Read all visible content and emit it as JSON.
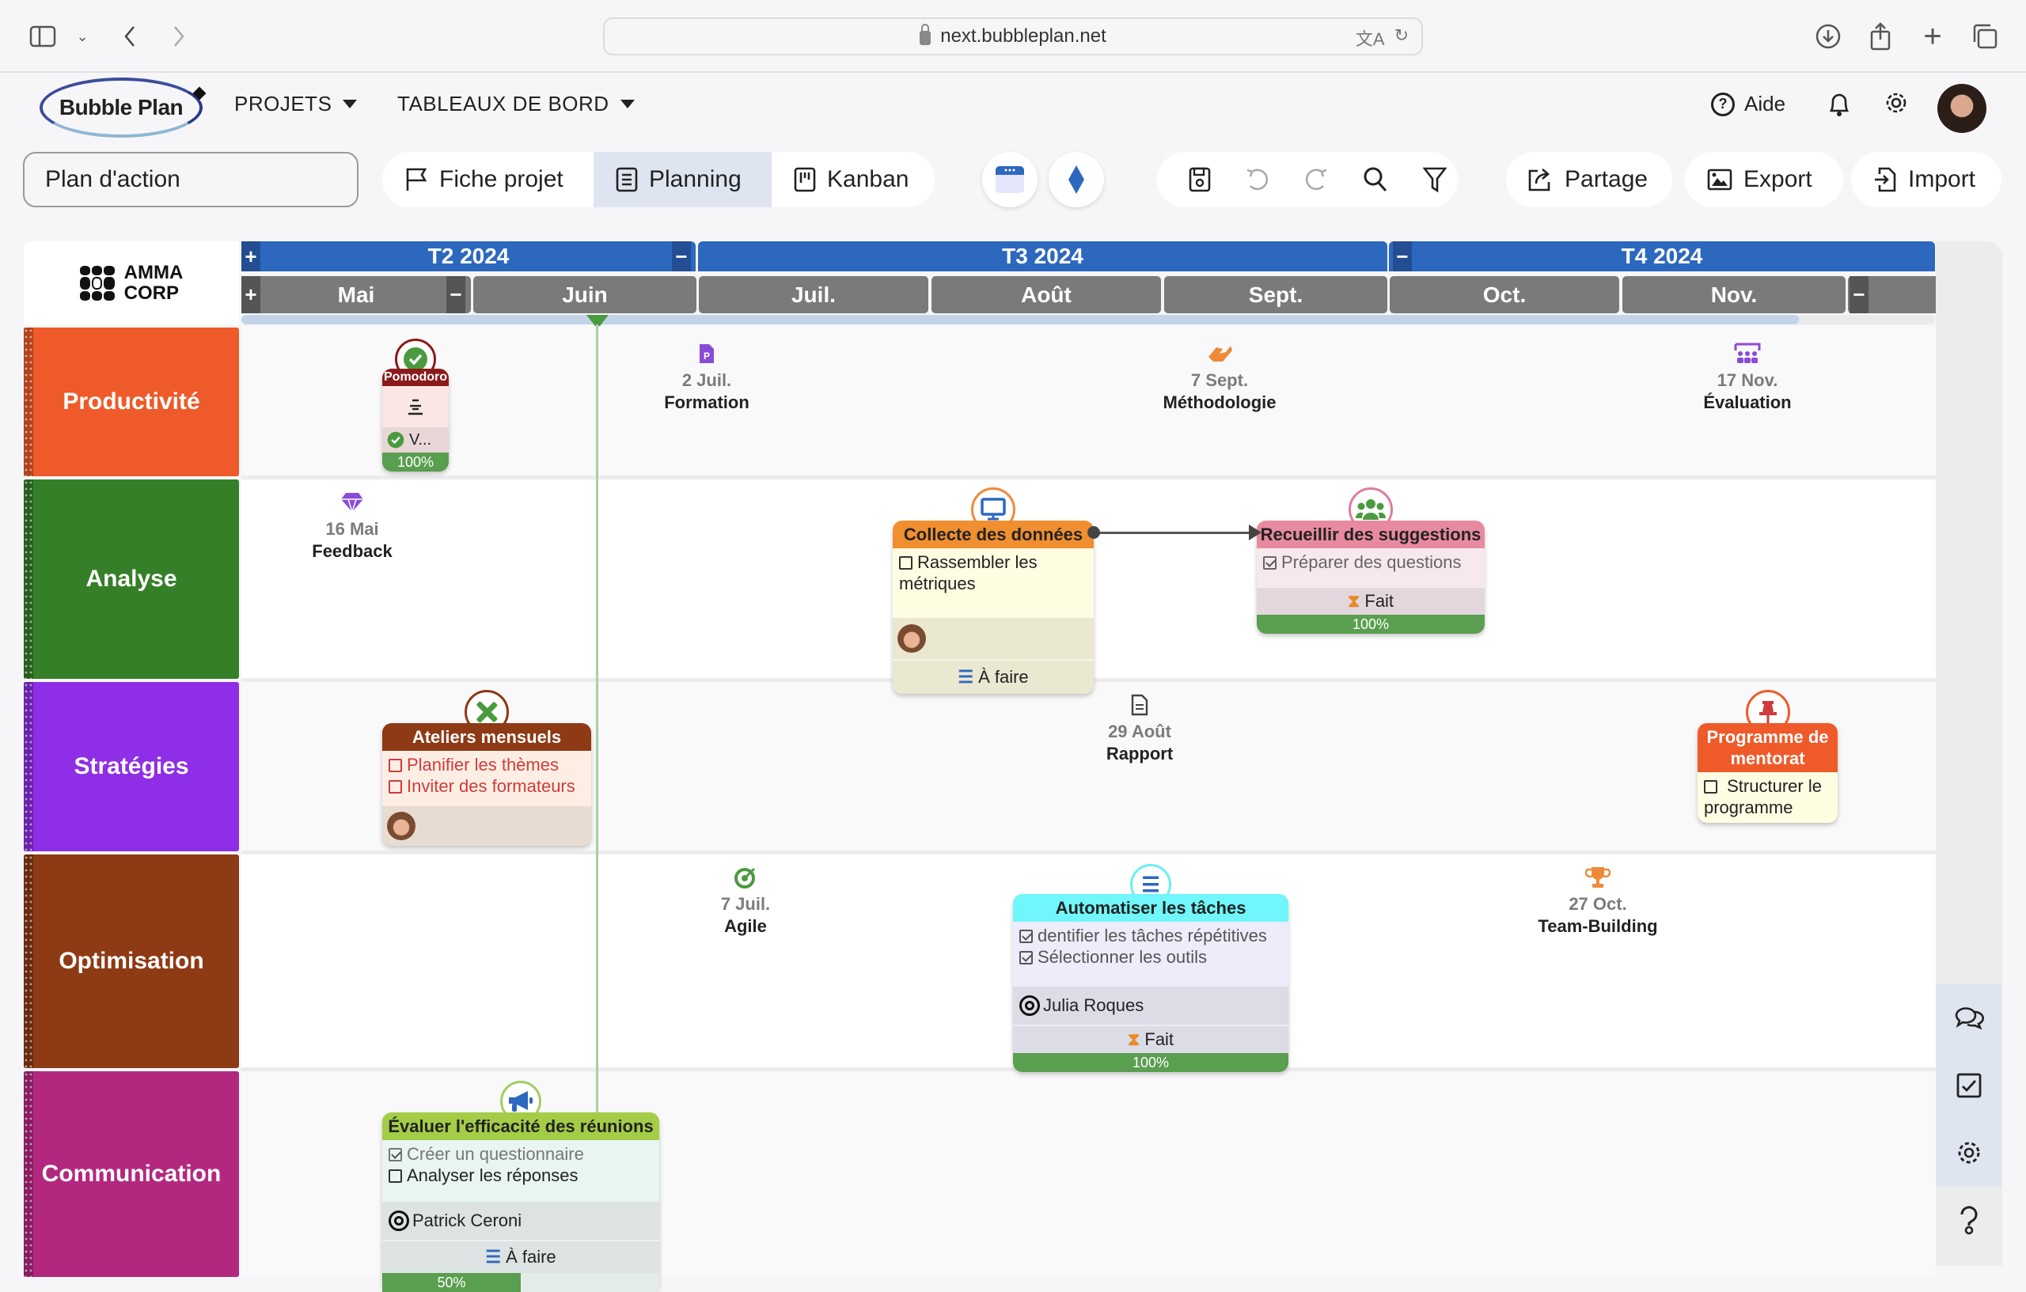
{
  "browser": {
    "url": "next.bubbleplan.net",
    "icons": [
      "sidebar-icon",
      "chevron-down-icon",
      "back-icon",
      "forward-icon",
      "translate-icon",
      "reload-icon",
      "download-icon",
      "share-icon",
      "new-tab-icon",
      "tabs-icon"
    ]
  },
  "appnav": {
    "logo": "Bubble Plan",
    "menus": [
      {
        "label": "PROJETS"
      },
      {
        "label": "TABLEAUX DE BORD"
      }
    ],
    "help_label": "Aide"
  },
  "toolbar": {
    "project_name": "Plan d'action",
    "views": [
      {
        "label": "Fiche projet",
        "icon": "flag-icon",
        "active": false
      },
      {
        "label": "Planning",
        "icon": "planning-icon",
        "active": true
      },
      {
        "label": "Kanban",
        "icon": "kanban-icon",
        "active": false
      }
    ],
    "actions": [
      "save-icon",
      "undo-icon",
      "redo-icon",
      "search-icon",
      "filter-icon"
    ],
    "share_label": "Partage",
    "export_label": "Export",
    "import_label": "Import"
  },
  "timeline": {
    "company": {
      "line1": "AMMA",
      "line2": "CORP"
    },
    "quarters": [
      {
        "label": "T2 2024"
      },
      {
        "label": "T3 2024"
      },
      {
        "label": "T4 2024"
      }
    ],
    "months": [
      {
        "label": "Mai"
      },
      {
        "label": "Juin"
      },
      {
        "label": "Juil."
      },
      {
        "label": "Août"
      },
      {
        "label": "Sept."
      },
      {
        "label": "Oct."
      },
      {
        "label": "Nov."
      }
    ],
    "controls": {
      "plus": "+",
      "minus": "−"
    },
    "today_month": "Juin"
  },
  "lanes": [
    {
      "label": "Productivité",
      "color": "#ee5a29"
    },
    {
      "label": "Analyse",
      "color": "#357f28"
    },
    {
      "label": "Stratégies",
      "color": "#8e2ee6"
    },
    {
      "label": "Optimisation",
      "color": "#8d3a15"
    },
    {
      "label": "Communication",
      "color": "#b3287f"
    }
  ],
  "milestones": [
    {
      "date": "2 Juil.",
      "name": "Formation",
      "icon": "file-powerpoint-icon",
      "lane": "Productivité"
    },
    {
      "date": "7 Sept.",
      "name": "Méthodologie",
      "icon": "handshake-icon",
      "lane": "Productivité"
    },
    {
      "date": "17 Nov.",
      "name": "Évaluation",
      "icon": "presentation-group-icon",
      "lane": "Productivité"
    },
    {
      "date": "16 Mai",
      "name": "Feedback",
      "icon": "gem-icon",
      "lane": "Analyse"
    },
    {
      "date": "29 Août",
      "name": "Rapport",
      "icon": "document-icon",
      "lane": "Stratégies"
    },
    {
      "date": "7 Juil.",
      "name": "Agile",
      "icon": "target-arrow-icon",
      "lane": "Optimisation"
    },
    {
      "date": "27 Oct.",
      "name": "Team-Building",
      "icon": "trophy-icon",
      "lane": "Optimisation"
    }
  ],
  "tasks": {
    "pomodoro": {
      "title": "Pomodoro",
      "assignee_short": "V...",
      "progress_label": "100%",
      "progress": 1.0
    },
    "collecte": {
      "title": "Collecte des données",
      "subtasks": [
        {
          "label": "Rassembler les métriques",
          "done": false
        }
      ],
      "status": "À faire"
    },
    "recueillir": {
      "title": "Recueillir des suggestions",
      "subtasks": [
        {
          "label": "Préparer des questions",
          "done": true
        }
      ],
      "status": "Fait",
      "progress_label": "100%",
      "progress": 1.0
    },
    "ateliers": {
      "title": "Ateliers mensuels",
      "subtasks": [
        {
          "label": "Planifier les thèmes",
          "done": false
        },
        {
          "label": "Inviter des formateurs",
          "done": false
        }
      ]
    },
    "mentorat": {
      "title": "Programme de mentorat",
      "subtasks": [
        {
          "label": "Structurer le programme",
          "done": false
        }
      ]
    },
    "automatiser": {
      "title": "Automatiser les tâches",
      "subtasks": [
        {
          "label": "dentifier les tâches répétitives",
          "done": true
        },
        {
          "label": "Sélectionner les outils",
          "done": true
        }
      ],
      "owner": "Julia Roques",
      "status": "Fait",
      "progress_label": "100%",
      "progress": 1.0
    },
    "evaluer": {
      "title": "Évaluer l'efficacité des réunions",
      "subtasks": [
        {
          "label": "Créer un questionnaire",
          "done": true
        },
        {
          "label": "Analyser les réponses",
          "done": false
        }
      ],
      "owner": "Patrick Ceroni",
      "status": "À faire",
      "progress_label": "50%",
      "progress": 0.5
    }
  },
  "right_rail": [
    "comments-icon",
    "checklist-icon",
    "settings-icon",
    "help-icon"
  ]
}
